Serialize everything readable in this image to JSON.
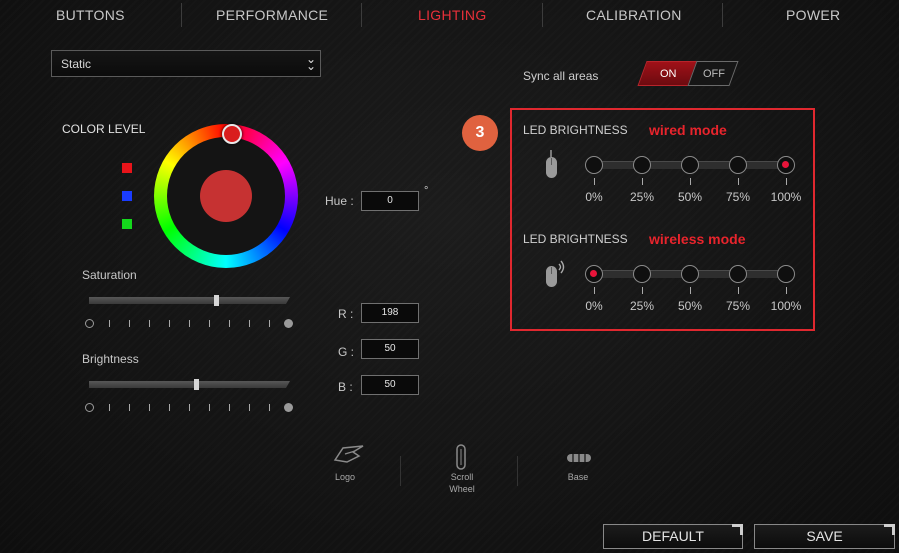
{
  "nav": {
    "tabs": [
      {
        "label": "BUTTONS"
      },
      {
        "label": "PERFORMANCE"
      },
      {
        "label": "LIGHTING"
      },
      {
        "label": "CALIBRATION"
      },
      {
        "label": "POWER"
      }
    ],
    "active": "LIGHTING"
  },
  "effect": {
    "selected": "Static"
  },
  "sync": {
    "label": "Sync all areas",
    "on_label": "ON",
    "off_label": "OFF",
    "state": "ON"
  },
  "color": {
    "title": "COLOR LEVEL",
    "swatches": [
      "#e8141a",
      "#1a3cff",
      "#14d81c"
    ],
    "current_color": "#c63232",
    "saturation_label": "Saturation",
    "saturation_value_pct": 63,
    "brightness_label": "Brightness",
    "brightness_value_pct": 53
  },
  "values": {
    "hue_label": "Hue :",
    "hue": "0",
    "degree": "°",
    "r_label": "R :",
    "r": "198",
    "g_label": "G :",
    "g": "50",
    "b_label": "B :",
    "b": "50"
  },
  "annotation": {
    "badge": "3",
    "highlight_color": "#e0282f"
  },
  "led": {
    "wired": {
      "title": "LED BRIGHTNESS",
      "mode": "wired mode",
      "selected_index": 4
    },
    "wireless": {
      "title": "LED BRIGHTNESS",
      "mode": "wireless mode",
      "selected_index": 0
    },
    "levels": [
      "0%",
      "25%",
      "50%",
      "75%",
      "100%"
    ]
  },
  "areas": [
    {
      "label": "Logo",
      "icon": "rog-logo-icon"
    },
    {
      "label": "Scroll\nWheel",
      "icon": "scroll-wheel-icon"
    },
    {
      "label": "Base",
      "icon": "mouse-base-icon"
    }
  ],
  "footer": {
    "default_label": "DEFAULT",
    "save_label": "SAVE"
  }
}
